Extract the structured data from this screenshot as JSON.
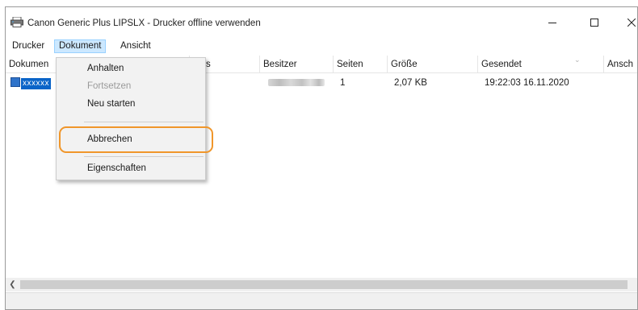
{
  "window": {
    "title": "Canon Generic Plus LIPSLX - Drucker offline verwenden",
    "controls": {
      "minimize_icon": "minimize-icon",
      "maximize_icon": "maximize-icon",
      "close_icon": "close-icon"
    }
  },
  "menubar": {
    "items": [
      {
        "label": "Drucker"
      },
      {
        "label": "Dokument",
        "active": true
      },
      {
        "label": "Ansicht"
      }
    ]
  },
  "columns": [
    {
      "label": "Dokumen"
    },
    {
      "label": "atus"
    },
    {
      "label": "Besitzer"
    },
    {
      "label": "Seiten"
    },
    {
      "label": "Größe"
    },
    {
      "label": "Gesendet"
    },
    {
      "label": "Ansch"
    }
  ],
  "rows": [
    {
      "document": "xxxxxx",
      "owner_redacted": true,
      "pages": "1",
      "size": "2,07 KB",
      "sent": "19:22:03  16.11.2020"
    }
  ],
  "dropdown": {
    "items": [
      {
        "label": "Anhalten",
        "enabled": true
      },
      {
        "label": "Fortsetzen",
        "enabled": false
      },
      {
        "label": "Neu starten",
        "enabled": true
      },
      {
        "label": "Abbrechen",
        "enabled": true,
        "highlighted": true
      },
      {
        "label": "Eigenschaften",
        "enabled": true
      }
    ]
  },
  "colors": {
    "highlight_ring": "#f0962a",
    "menu_active_bg": "#cce8ff",
    "selection": "#0a64c8"
  }
}
